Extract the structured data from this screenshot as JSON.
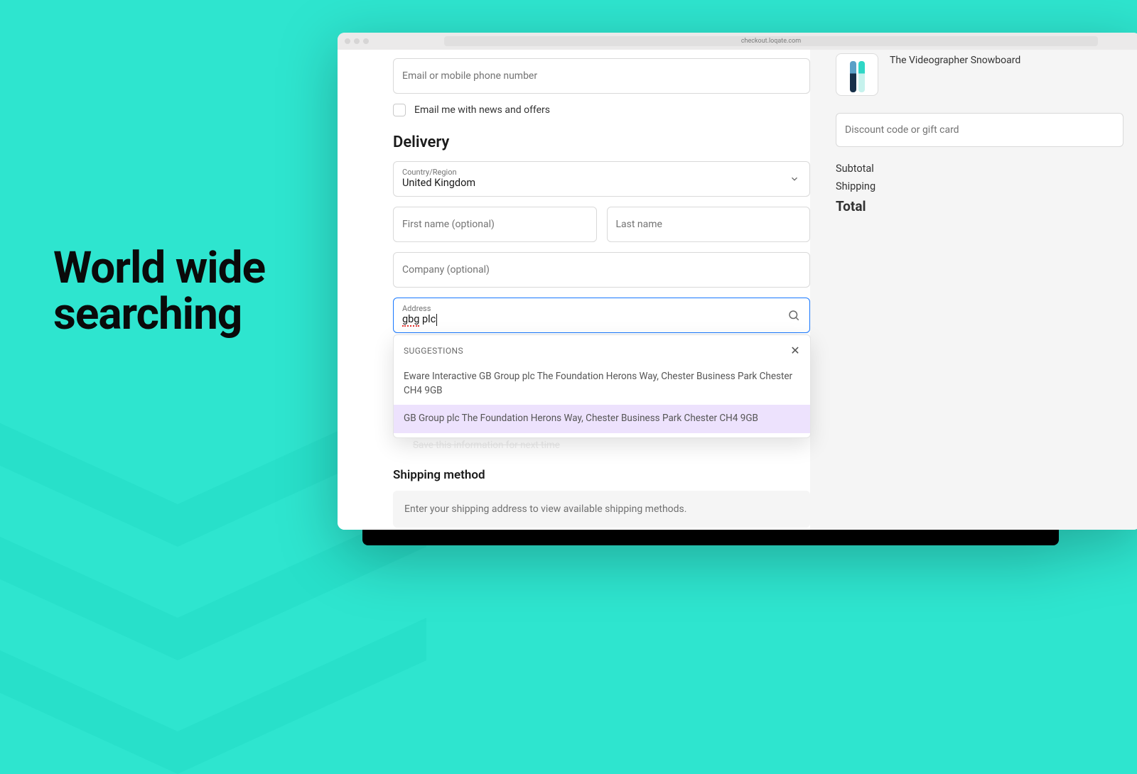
{
  "hero": {
    "line1": "World wide",
    "line2": "searching"
  },
  "browser": {
    "url": "checkout.loqate.com"
  },
  "contact": {
    "placeholder": "Email or mobile phone number",
    "newsletter_label": "Email me with news and offers"
  },
  "delivery": {
    "heading": "Delivery",
    "country_label": "Country/Region",
    "country_value": "United Kingdom",
    "first_name_placeholder": "First name (optional)",
    "last_name_placeholder": "Last name",
    "company_placeholder": "Company (optional)",
    "address_label": "Address",
    "address_value_misspelled": "gbg",
    "address_value_rest": " plc"
  },
  "suggestions": {
    "header": "SUGGESTIONS",
    "items": [
      "Eware Interactive GB Group plc The Foundation Herons Way, Chester Business Park Chester CH4 9GB",
      "GB Group plc The Foundation Herons Way, Chester Business Park Chester CH4 9GB"
    ]
  },
  "save_info_partial": "Save this information for next time",
  "shipping": {
    "heading": "Shipping method",
    "note": "Enter your shipping address to view available shipping methods."
  },
  "cart": {
    "item_name": "The Videographer Snowboard",
    "discount_placeholder": "Discount code or gift card",
    "subtotal_label": "Subtotal",
    "shipping_label": "Shipping",
    "total_label": "Total"
  }
}
